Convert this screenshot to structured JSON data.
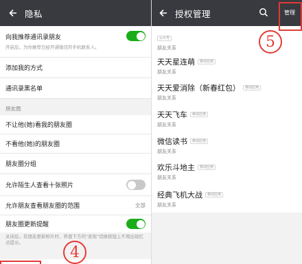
{
  "left": {
    "title": "隐私",
    "rows": {
      "recommend_label": "向我推荐通讯录朋友",
      "recommend_desc": "开启后，为你推荐已经开通微信的手机联系人。",
      "add_methods": "添加我的方式",
      "blacklist": "通讯录黑名单",
      "moments_section": "朋友圈",
      "hide_from_them": "不让他(她)看我的朋友圈",
      "hide_them": "不看他(她)的朋友圈",
      "moments_groups": "朋友圈分组",
      "stranger_ten": "允许陌生人查看十张照片",
      "visible_range": "允许朋友查看朋友圈的范围",
      "visible_range_value": "全部",
      "moments_reminder": "朋友圈更新提醒",
      "reminder_desc": "关闭后，有朋友更新照片时，界面下方的\"发现\"切换按钮上不再出现红点提示。"
    },
    "toggles": {
      "recommend": true,
      "stranger_ten": false,
      "moments_reminder": true
    },
    "annotation": "4"
  },
  "right": {
    "title": "授权管理",
    "manage_label": "管理",
    "apps": [
      {
        "tag": "公众号",
        "name": "",
        "scope": "朋友关系"
      },
      {
        "name": "天天星连萌",
        "tag": "移动应用",
        "scope": "朋友关系"
      },
      {
        "name": "天天爱消除（新春红包）",
        "tag": "移动应用",
        "scope": "朋友关系"
      },
      {
        "name": "天天飞车",
        "tag": "移动应用",
        "scope": "朋友关系"
      },
      {
        "name": "微信读书",
        "tag": "移动应用",
        "scope": "朋友关系"
      },
      {
        "name": "欢乐斗地主",
        "tag": "移动应用",
        "scope": "朋友关系"
      },
      {
        "name": "经典飞机大战",
        "tag": "移动应用",
        "scope": "朋友关系"
      }
    ],
    "annotation": "5"
  },
  "colors": {
    "topbar": "#393a3f",
    "toggle_on": "#1aad19",
    "annotation": "#e53935"
  }
}
